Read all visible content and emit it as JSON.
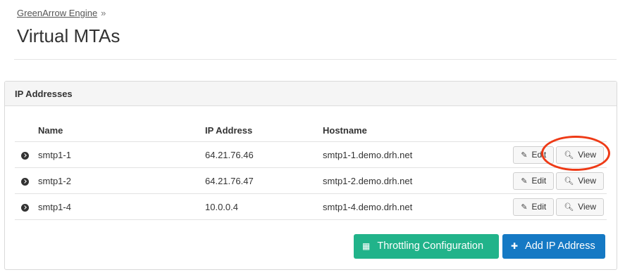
{
  "breadcrumb": {
    "parent": "GreenArrow Engine",
    "separator": "»"
  },
  "page": {
    "title": "Virtual MTAs"
  },
  "panel": {
    "title": "IP Addresses"
  },
  "table": {
    "headers": {
      "name": "Name",
      "ip": "IP Address",
      "hostname": "Hostname"
    },
    "rows": [
      {
        "name": "smtp1-1",
        "ip": "64.21.76.46",
        "hostname": "smtp1-1.demo.drh.net"
      },
      {
        "name": "smtp1-2",
        "ip": "64.21.76.47",
        "hostname": "smtp1-2.demo.drh.net"
      },
      {
        "name": "smtp1-4",
        "ip": "10.0.0.4",
        "hostname": "smtp1-4.demo.drh.net"
      }
    ],
    "edit_label": "Edit",
    "view_label": "View"
  },
  "actions": {
    "throttling_label": "Throttling Configuration",
    "add_ip_label": "Add IP Address"
  },
  "icons": {
    "expand": "chevron-circle-right-icon",
    "edit": "edit-icon",
    "view": "search-icon",
    "table": "table-icon",
    "plus": "plus-icon"
  },
  "colors": {
    "throttling_button": "#21b38a",
    "add_button": "#1579c4",
    "highlight_circle": "#ee3a16"
  }
}
